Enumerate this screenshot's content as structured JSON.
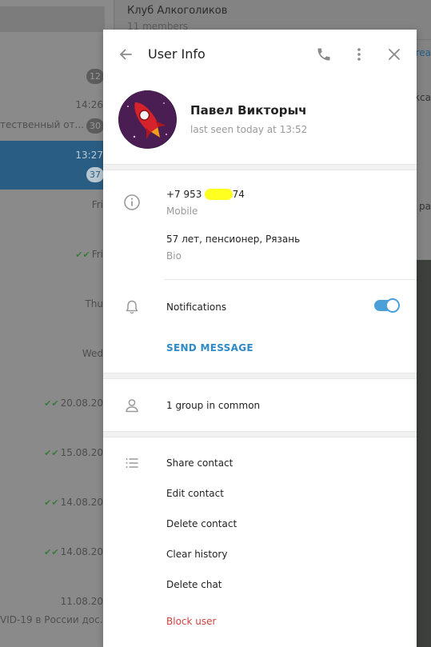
{
  "background": {
    "chat_header": {
      "title": "Клуб Алкоголиков",
      "subtitle": "11 members"
    },
    "chat_list": [
      {
        "time": "",
        "badge": "12",
        "snippet": ""
      },
      {
        "time": "14:26",
        "badge": "30",
        "snippet": "тественный от..."
      },
      {
        "time": "13:27",
        "badge": "37",
        "snippet": ""
      },
      {
        "time": "Fri",
        "badge": "",
        "snippet": ""
      },
      {
        "time": "Fri",
        "badge": "",
        "snippet": "",
        "checked": true
      },
      {
        "time": "Thu",
        "badge": "",
        "snippet": ""
      },
      {
        "time": "Wed",
        "badge": "",
        "snippet": ""
      },
      {
        "time": "20.08.20",
        "badge": "",
        "snippet": "",
        "checked": true
      },
      {
        "time": "15.08.20",
        "badge": "",
        "snippet": "",
        "checked": true
      },
      {
        "time": "14.08.20",
        "badge": "",
        "snippet": "",
        "checked": true
      },
      {
        "time": "14.08.20",
        "badge": "",
        "snippet": "",
        "checked": true
      },
      {
        "time": "11.08.20",
        "badge": "",
        "snippet": "VID-19 в России дос..."
      }
    ],
    "right_peek": [
      "rea",
      "кса",
      "ра"
    ]
  },
  "modal": {
    "title": "User Info",
    "user": {
      "name": "Павел Викторыч",
      "last_seen": "last seen today at 13:52"
    },
    "info": {
      "phone_prefix": "+7 953",
      "phone_suffix": "74",
      "phone_label": "Mobile",
      "bio": "57 лет, пенсионер, Рязань",
      "bio_label": "Bio"
    },
    "notifications_label": "Notifications",
    "notifications_on": true,
    "send_message": "SEND MESSAGE",
    "groups_in_common": "1 group in common",
    "actions": [
      "Share contact",
      "Edit contact",
      "Delete contact",
      "Clear history",
      "Delete chat"
    ],
    "block_user": "Block user"
  },
  "colors": {
    "accent": "#4ca0d8",
    "link": "#2e8ac6",
    "danger": "#d14040",
    "highlight_mark": "#ffff20"
  }
}
